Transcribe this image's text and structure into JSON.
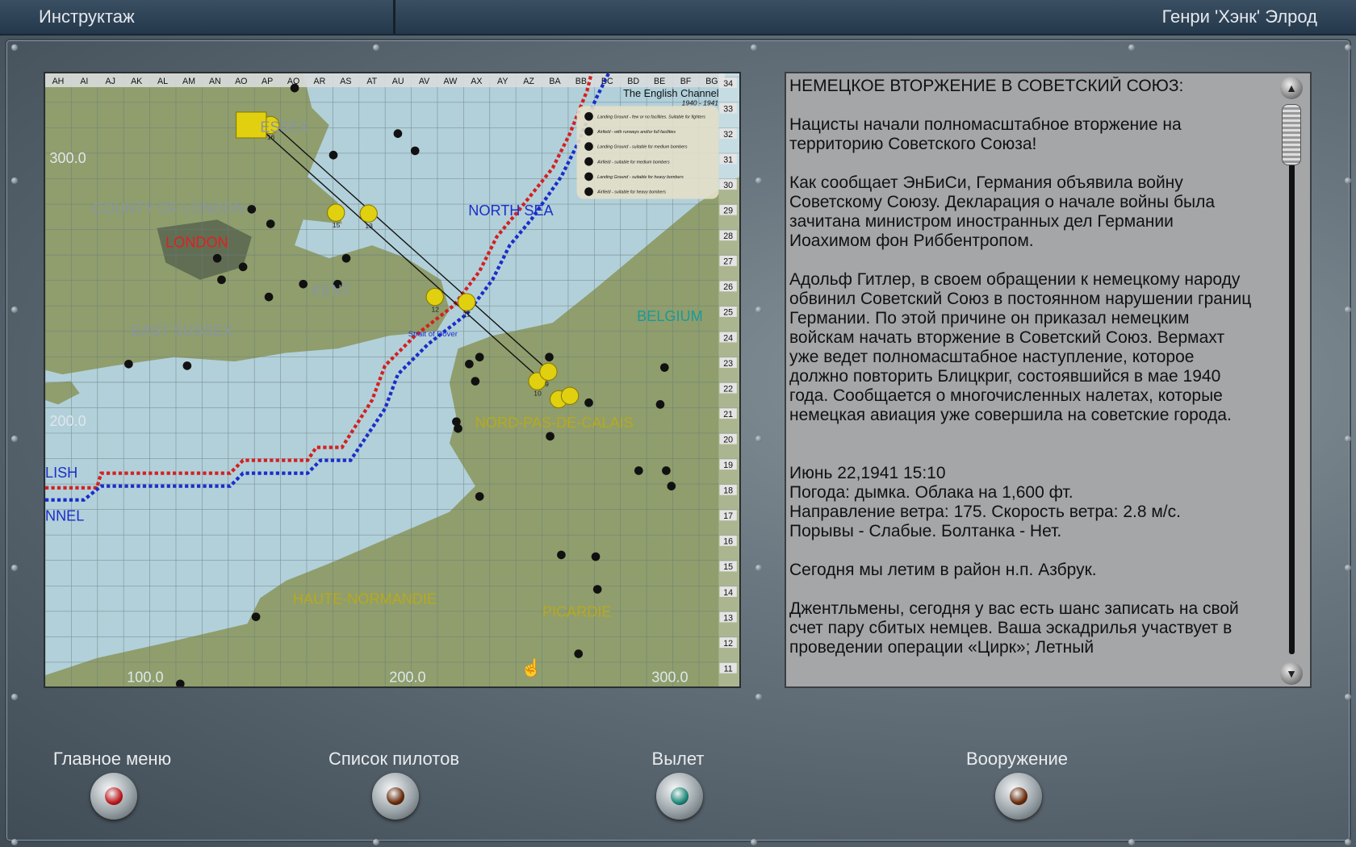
{
  "header": {
    "title": "Инструктаж",
    "pilot": "Генри 'Хэнк' Элрод"
  },
  "map": {
    "columns": [
      "AH",
      "AI",
      "AJ",
      "AK",
      "AL",
      "AM",
      "AN",
      "AO",
      "AP",
      "AQ",
      "AR",
      "AS",
      "AT",
      "AU",
      "AV",
      "AW",
      "AX",
      "AY",
      "AZ",
      "BA",
      "BB",
      "BC",
      "BD",
      "BE",
      "BF",
      "BG"
    ],
    "rows": [
      "34",
      "33",
      "32",
      "31",
      "30",
      "29",
      "28",
      "27",
      "26",
      "25",
      "24",
      "23",
      "22",
      "21",
      "20",
      "19",
      "18",
      "17",
      "16",
      "15",
      "14",
      "13",
      "12",
      "11"
    ],
    "legend_title": "The English Channel",
    "legend_years": "1940 - 1941",
    "legend": [
      "Landing Ground - few or no facilities. Suitable for fighters",
      "Airfield - with runways and/or full facilities",
      "Landing Ground - suitable for medium bombers",
      "Airfield - suitable for medium bombers",
      "Landing Ground - suitable for heavy bombers",
      "Airfield - suitable for heavy bombers"
    ],
    "labels": {
      "essex": "ESSEX",
      "county_london": "COUNTY OF LONDON",
      "london": "LONDON",
      "kent": "KENT",
      "east_sussex": "EAST SUSSEX",
      "north_sea": "NORTH SEA",
      "belgium": "BELGIUM",
      "strait": "Strait of Dover",
      "npdc": "NORD-PAS-DE-CALAIS",
      "haute_normandie": "HAUTE-NORMANDIE",
      "picardie": "PICARDIE",
      "english": "LISH",
      "channel": "NNEL"
    },
    "grid_values": {
      "y300": "300.0",
      "y200": "200.0",
      "x100": "100.0",
      "x200": "200.0",
      "x300": "300.0"
    },
    "waypoint_numbers": [
      "16",
      "14",
      "15",
      "13",
      "12",
      "11",
      "10",
      "9"
    ],
    "colors": {
      "red_front": "#d42020",
      "blue_front": "#1a2ec8",
      "waypoint": "#e0d010"
    }
  },
  "briefing": {
    "paragraphs": [
      "НЕМЕЦКОЕ ВТОРЖЕНИЕ В СОВЕТСКИЙ СОЮЗ:",
      "Нацисты начали полномасштабное вторжение на территорию Советского Союза!",
      "Как сообщает ЭнБиСи, Германия объявила войну Советскому Союзу. Декларация о начале войны была зачитана министром иностранных дел Германии Иоахимом фон Риббентропом.",
      "Адольф Гитлер, в своем обращении к немецкому народу обвинил Советский Союз в постоянном нарушении границ Германии. По этой причине он приказал немецким войскам начать вторжение в Советский Союз. Вермахт уже ведет полномасштабное наступление, которое должно повторить Блицкриг, состоявшийся в мае 1940 года. Сообщается о многочисленных налетах, которые немецкая авиация уже совершила на советские города.",
      "\nИюнь 22,1941 15:10\nПогода: дымка. Облака на 1,600 фт.\nНаправление ветра: 175. Скорость ветра: 2.8 м/с.\nПорывы - Слабые. Болтанка - Нет.",
      "Сегодня мы летим в район н.п. Азбрук.",
      "Джентльмены, сегодня у вас есть шанс записать на свой счет пару сбитых немцев. Ваша эскадрилья участвует в проведении операции «Цирк»; Летный"
    ]
  },
  "buttons": [
    {
      "label": "Главное меню",
      "color": "#c0181c"
    },
    {
      "label": "Список пилотов",
      "color": "#6a2a08"
    },
    {
      "label": "Вылет",
      "color": "#1a8a7a"
    },
    {
      "label": "Вооружение",
      "color": "#6a2a08"
    }
  ]
}
